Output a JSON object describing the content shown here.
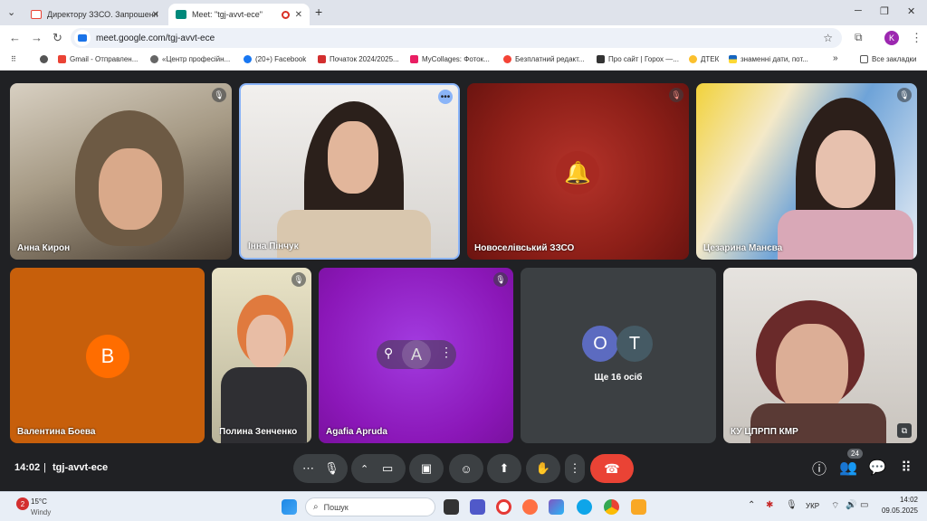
{
  "browser": {
    "tabs": [
      {
        "title": "Директору ЗЗСО. Запрошення",
        "active": false
      },
      {
        "title": "Meet: \"tgj-avvt-ece\"",
        "active": true
      }
    ],
    "new_tab_symbol": "+",
    "url": "meet.google.com/tgj-avvt-ece",
    "profile_initial": "K",
    "all_bookmarks_label": "Все закладки",
    "bookmarks": [
      "Gmail - Отправлен...",
      "«Центр професійн...",
      "(20+) Facebook",
      "Початок 2024/2025...",
      "MyCollages: Фоток...",
      "Безплатний редакт...",
      "Про сайт | Горох —...",
      "ДТЕК",
      "знаменні дати, пот..."
    ]
  },
  "participants": [
    {
      "name": "Анна Кирон",
      "muted": true
    },
    {
      "name": "Інна Пінчук",
      "muted": false,
      "active": true
    },
    {
      "name": "Новоселівський ЗЗСО",
      "muted": true
    },
    {
      "name": "Цезарина Манєва",
      "muted": true
    },
    {
      "name": "Валентина Боева",
      "muted": false,
      "initial": "В"
    },
    {
      "name": "Полина Зенченко",
      "muted": true
    },
    {
      "name": "Agafia Apruda",
      "muted": true,
      "initial": "A"
    },
    {
      "name": "КУ ЦПРПП КМР",
      "muted": false
    }
  ],
  "others_tile": {
    "initials": [
      "О",
      "Т"
    ],
    "label": "Ще 16 осіб"
  },
  "meeting": {
    "time": "14:02",
    "code": "tgj-avvt-ece",
    "participant_count": "24"
  },
  "taskbar": {
    "weather_temp": "15°C",
    "weather_desc": "Windy",
    "weather_badge": "2",
    "search_placeholder": "Пошук",
    "language": "УКР",
    "clock_time": "14:02",
    "clock_date": "09.05.2025"
  },
  "colors": {
    "meet_bg": "#202124",
    "hangup": "#ea4335",
    "valentina_tile": "#c75f0b",
    "agafia_tile": "#8b17b8",
    "o_avatar": "#5c6bc0",
    "t_avatar": "#455a64"
  }
}
